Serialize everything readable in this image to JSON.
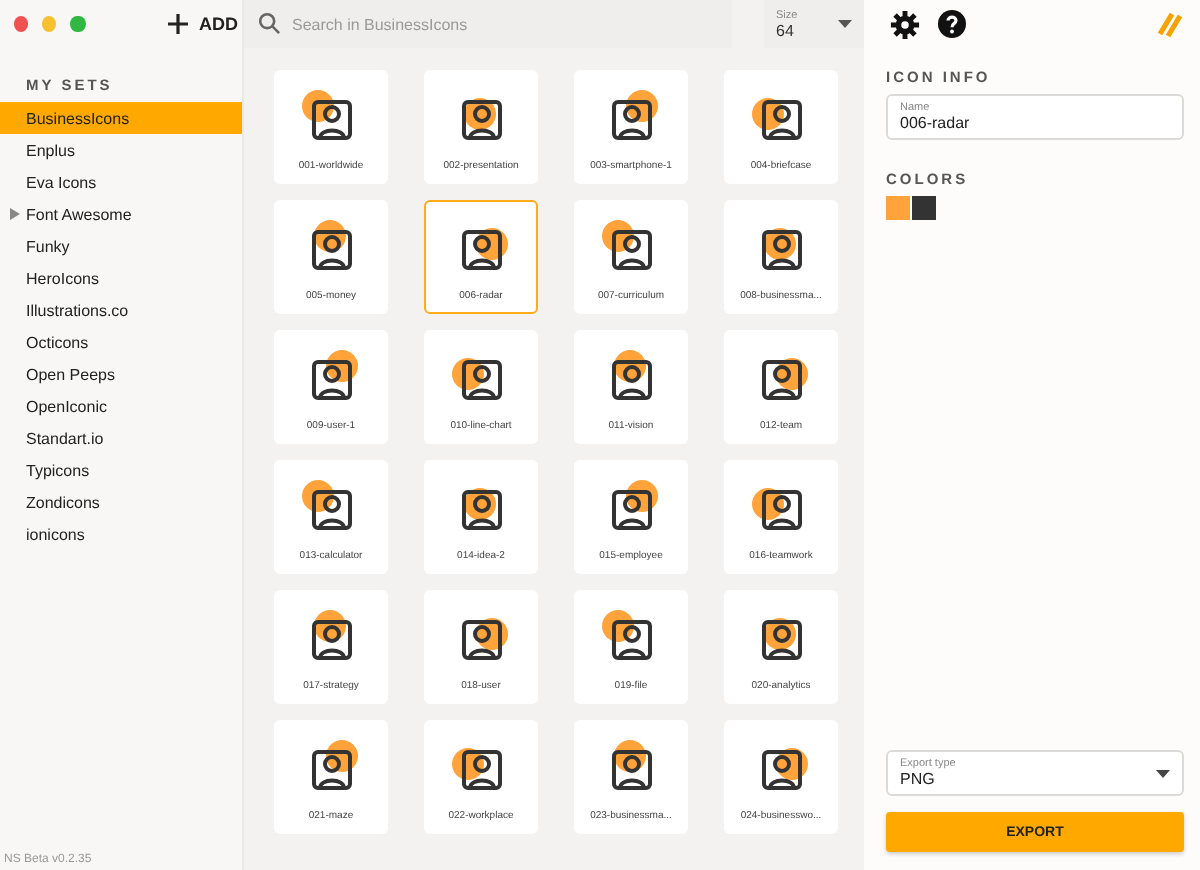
{
  "toolbar": {
    "add_label": "ADD",
    "search": {
      "placeholder": "Search in BusinessIcons"
    },
    "size": {
      "label": "Size",
      "value": "64"
    }
  },
  "sidebar": {
    "heading": "MY SETS",
    "items": [
      {
        "label": "BusinessIcons",
        "selected": true,
        "expandable": false
      },
      {
        "label": "Enplus",
        "selected": false,
        "expandable": false
      },
      {
        "label": "Eva Icons",
        "selected": false,
        "expandable": false
      },
      {
        "label": "Font Awesome",
        "selected": false,
        "expandable": true
      },
      {
        "label": "Funky",
        "selected": false,
        "expandable": false
      },
      {
        "label": "HeroIcons",
        "selected": false,
        "expandable": false
      },
      {
        "label": "Illustrations.co",
        "selected": false,
        "expandable": false
      },
      {
        "label": "Octicons",
        "selected": false,
        "expandable": false
      },
      {
        "label": "Open Peeps",
        "selected": false,
        "expandable": false
      },
      {
        "label": "OpenIconic",
        "selected": false,
        "expandable": false
      },
      {
        "label": "Standart.io",
        "selected": false,
        "expandable": false
      },
      {
        "label": "Typicons",
        "selected": false,
        "expandable": false
      },
      {
        "label": "Zondicons",
        "selected": false,
        "expandable": false
      },
      {
        "label": "ionicons",
        "selected": false,
        "expandable": false
      }
    ],
    "version": "NS Beta v0.2.35"
  },
  "icons": [
    {
      "label": "001-worldwide",
      "selected": false
    },
    {
      "label": "002-presentation",
      "selected": false
    },
    {
      "label": "003-smartphone-1",
      "selected": false
    },
    {
      "label": "004-briefcase",
      "selected": false
    },
    {
      "label": "005-money",
      "selected": false
    },
    {
      "label": "006-radar",
      "selected": true
    },
    {
      "label": "007-curriculum",
      "selected": false
    },
    {
      "label": "008-businessma...",
      "selected": false
    },
    {
      "label": "009-user-1",
      "selected": false
    },
    {
      "label": "010-line-chart",
      "selected": false
    },
    {
      "label": "011-vision",
      "selected": false
    },
    {
      "label": "012-team",
      "selected": false
    },
    {
      "label": "013-calculator",
      "selected": false
    },
    {
      "label": "014-idea-2",
      "selected": false
    },
    {
      "label": "015-employee",
      "selected": false
    },
    {
      "label": "016-teamwork",
      "selected": false
    },
    {
      "label": "017-strategy",
      "selected": false
    },
    {
      "label": "018-user",
      "selected": false
    },
    {
      "label": "019-file",
      "selected": false
    },
    {
      "label": "020-analytics",
      "selected": false
    },
    {
      "label": "021-maze",
      "selected": false
    },
    {
      "label": "022-workplace",
      "selected": false
    },
    {
      "label": "023-businessma...",
      "selected": false
    },
    {
      "label": "024-businesswo...",
      "selected": false
    }
  ],
  "info": {
    "heading": "ICON INFO",
    "name_label": "Name",
    "name_value": "006-radar",
    "colors_heading": "COLORS",
    "colors": [
      {
        "color": "#ffa33a"
      },
      {
        "color": "#333333"
      }
    ],
    "export_type": {
      "label": "Export type",
      "value": "PNG"
    },
    "export_button": "EXPORT"
  }
}
